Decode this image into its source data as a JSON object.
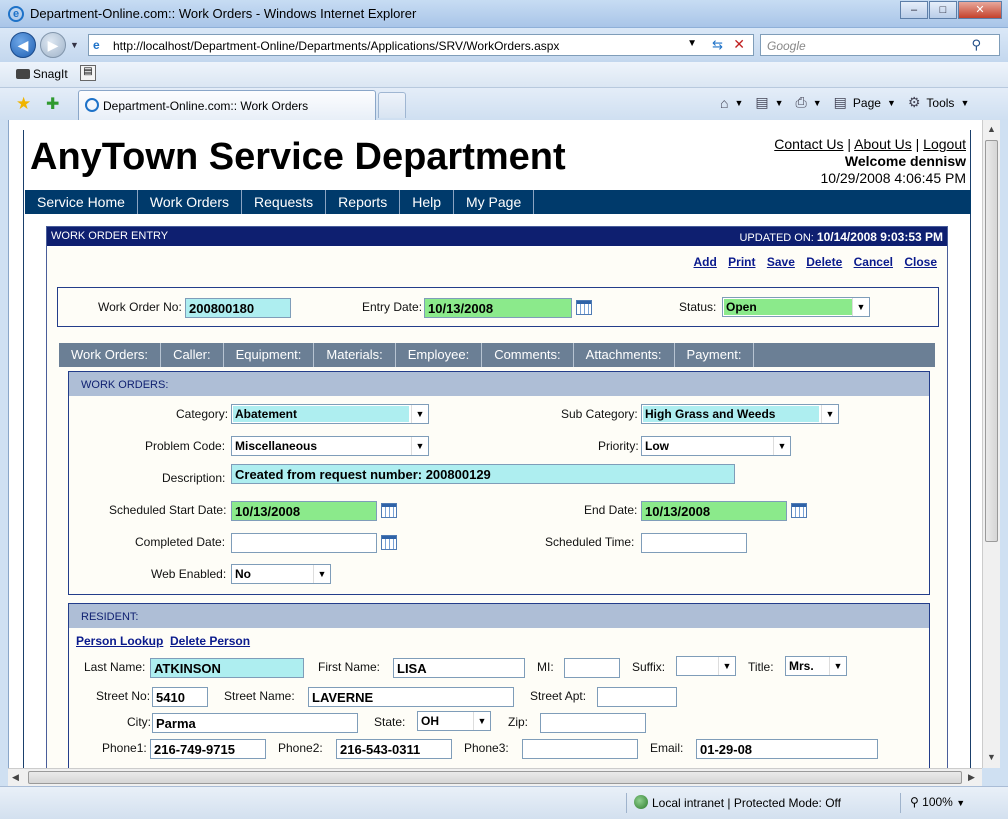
{
  "window": {
    "title": "Department-Online.com:: Work Orders - Windows Internet Explorer",
    "address": "http://localhost/Department-Online/Departments/Applications/SRV/WorkOrders.aspx",
    "search_placeholder": "Google",
    "snagit_label": "SnagIt",
    "tab_label": "Department-Online.com:: Work Orders",
    "page_label": "Page",
    "tools_label": "Tools",
    "status_zone": "Local intranet | Protected Mode: Off",
    "zoom": "100%"
  },
  "site": {
    "title": "AnyTown Service Department",
    "links": {
      "contact": "Contact Us",
      "about": "About Us",
      "logout": "Logout"
    },
    "welcome": "Welcome dennisw",
    "datetime": "10/29/2008 4:06:45 PM",
    "nav": [
      "Service Home",
      "Work Orders",
      "Requests",
      "Reports",
      "Help",
      "My Page"
    ]
  },
  "entry": {
    "header_title": "WORK ORDER ENTRY",
    "updated_label": "UPDATED ON:",
    "updated_value": "10/14/2008 9:03:53 PM",
    "actions": {
      "add": "Add",
      "print": "Print",
      "save": "Save",
      "delete": "Delete",
      "cancel": "Cancel",
      "close": "Close"
    },
    "work_order_no_label": "Work Order No:",
    "work_order_no": "200800180",
    "entry_date_label": "Entry Date:",
    "entry_date": "10/13/2008",
    "status_label": "Status:",
    "status": "Open"
  },
  "subtabs": [
    "Work Orders:",
    "Caller:",
    "Equipment:",
    "Materials:",
    "Employee:",
    "Comments:",
    "Attachments:",
    "Payment:"
  ],
  "work_orders": {
    "header": "WORK ORDERS:",
    "category_label": "Category:",
    "category": "Abatement",
    "sub_category_label": "Sub Category:",
    "sub_category": "High Grass and Weeds",
    "problem_code_label": "Problem Code:",
    "problem_code": "Miscellaneous",
    "priority_label": "Priority:",
    "priority": "Low",
    "description_label": "Description:",
    "description": "Created from request number: 200800129",
    "sched_start_label": "Scheduled Start Date:",
    "sched_start": "10/13/2008",
    "end_date_label": "End Date:",
    "end_date": "10/13/2008",
    "completed_label": "Completed Date:",
    "completed": "",
    "sched_time_label": "Scheduled Time:",
    "sched_time": "",
    "web_enabled_label": "Web Enabled:",
    "web_enabled": "No"
  },
  "resident": {
    "header": "RESIDENT:",
    "person_lookup": "Person Lookup",
    "delete_person": "Delete Person",
    "last_name_label": "Last Name:",
    "last_name": "ATKINSON",
    "first_name_label": "First Name:",
    "first_name": "LISA",
    "mi_label": "MI:",
    "mi": "",
    "suffix_label": "Suffix:",
    "suffix": "",
    "title_label": "Title:",
    "title": "Mrs.",
    "street_no_label": "Street No:",
    "street_no": "5410",
    "street_name_label": "Street Name:",
    "street_name": "LAVERNE",
    "street_apt_label": "Street Apt:",
    "street_apt": "",
    "city_label": "City:",
    "city": "Parma",
    "state_label": "State:",
    "state": "OH",
    "zip_label": "Zip:",
    "zip": "",
    "phone1_label": "Phone1:",
    "phone1": "216-749-9715",
    "phone2_label": "Phone2:",
    "phone2": "216-543-0311",
    "phone3_label": "Phone3:",
    "phone3": "",
    "email_label": "Email:",
    "email": "01-29-08"
  },
  "colors": {
    "nav_bg": "#003a6b",
    "header_bg": "#0e1f70",
    "required_cyan": "#aeeef0",
    "date_green": "#8bea8b",
    "subtab_bg": "#6b7f95",
    "section_header": "#aebed6"
  }
}
